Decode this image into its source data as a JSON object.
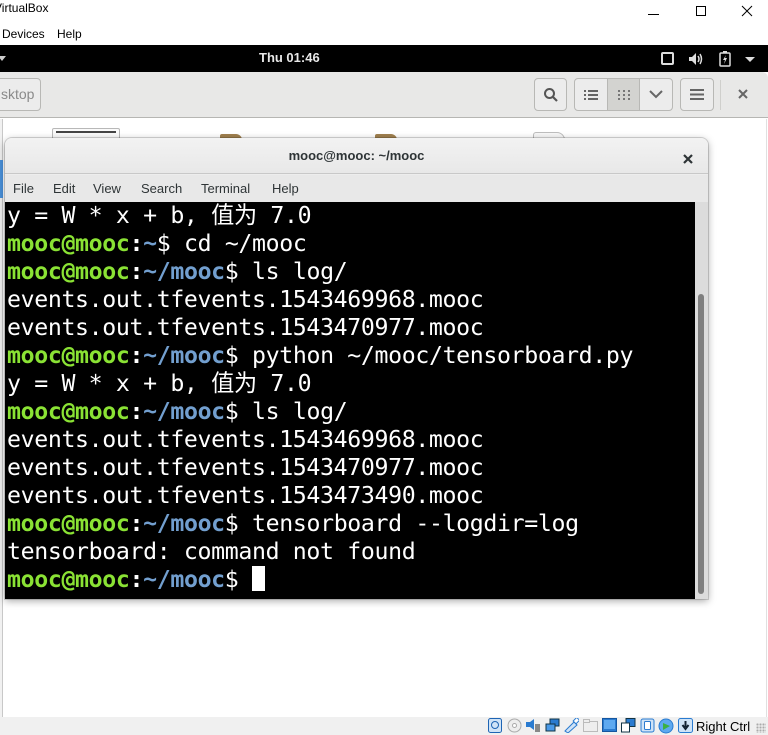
{
  "host_window": {
    "title": "VirtualBox",
    "menu": [
      "Devices",
      "Help"
    ],
    "controls": {
      "minimize": "minimize",
      "maximize": "maximize",
      "close": "close"
    }
  },
  "gnome_topbar": {
    "clock": "Thu 01:46",
    "tray_icons": [
      "window-icon",
      "volume-icon",
      "battery-charging-icon",
      "system-menu-arrow-icon"
    ]
  },
  "file_manager": {
    "path_button": "Desktop",
    "path_button_visible": "sktop",
    "header_buttons": [
      "search",
      "list-view",
      "grid-view",
      "view-options",
      "menu",
      "close"
    ]
  },
  "terminal": {
    "title": "mooc@mooc: ~/mooc",
    "menu": [
      "File",
      "Edit",
      "View",
      "Search",
      "Terminal",
      "Help"
    ],
    "prompt": {
      "user_host": "mooc@mooc",
      "colon": ":",
      "dollar": "$ "
    },
    "lines": [
      {
        "type": "output",
        "text": "y = W * x + b, 值为 7.0"
      },
      {
        "type": "prompt",
        "path": "~",
        "command": "cd ~/mooc"
      },
      {
        "type": "prompt",
        "path": "~/mooc",
        "command": "ls log/"
      },
      {
        "type": "output",
        "text": "events.out.tfevents.1543469968.mooc"
      },
      {
        "type": "output",
        "text": "events.out.tfevents.1543470977.mooc"
      },
      {
        "type": "prompt",
        "path": "~/mooc",
        "command": "python ~/mooc/tensorboard.py"
      },
      {
        "type": "output",
        "text": "y = W * x + b, 值为 7.0"
      },
      {
        "type": "prompt",
        "path": "~/mooc",
        "command": "ls log/"
      },
      {
        "type": "output",
        "text": "events.out.tfevents.1543469968.mooc"
      },
      {
        "type": "output",
        "text": "events.out.tfevents.1543470977.mooc"
      },
      {
        "type": "output",
        "text": "events.out.tfevents.1543473490.mooc"
      },
      {
        "type": "prompt",
        "path": "~/mooc",
        "command": "tensorboard --logdir=log"
      },
      {
        "type": "output",
        "text": "tensorboard: command not found"
      },
      {
        "type": "prompt",
        "path": "~/mooc",
        "command": "",
        "cursor": true
      }
    ],
    "colors": {
      "user": "#8ae234",
      "path": "#729fcf",
      "text": "#ffffff",
      "background": "#000000"
    }
  },
  "vbox_status": {
    "icons": [
      "hard-disk-icon",
      "optical-drive-icon",
      "audio-icon",
      "network-icon",
      "usb-icon",
      "shared-folders-icon",
      "display-icon",
      "video-capture-icon",
      "cpu-icon",
      "mouse-integration-icon",
      "keyboard-capture-icon"
    ],
    "host_key": "Right Ctrl"
  }
}
